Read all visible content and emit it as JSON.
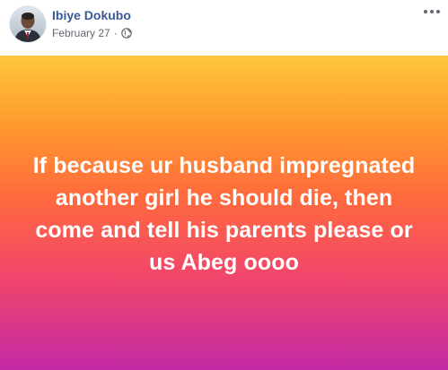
{
  "post": {
    "author": {
      "name": "Ibiye Dokubo",
      "avatar_icon": "profile-photo"
    },
    "timestamp": "February 27",
    "separator": "·",
    "privacy_icon": "globe-icon",
    "more_options_icon": "ellipsis-icon",
    "status": {
      "text": "If because ur husband impregnated another girl he should die, then come and tell his parents please or us Abeg oooo",
      "text_color": "#ffffff",
      "background_gradient": [
        "#fec73b",
        "#ff9a2e",
        "#ff6a3d",
        "#f2466a",
        "#c22aa5"
      ]
    }
  },
  "colors": {
    "author_name": "#385898",
    "meta_text": "#616770"
  }
}
